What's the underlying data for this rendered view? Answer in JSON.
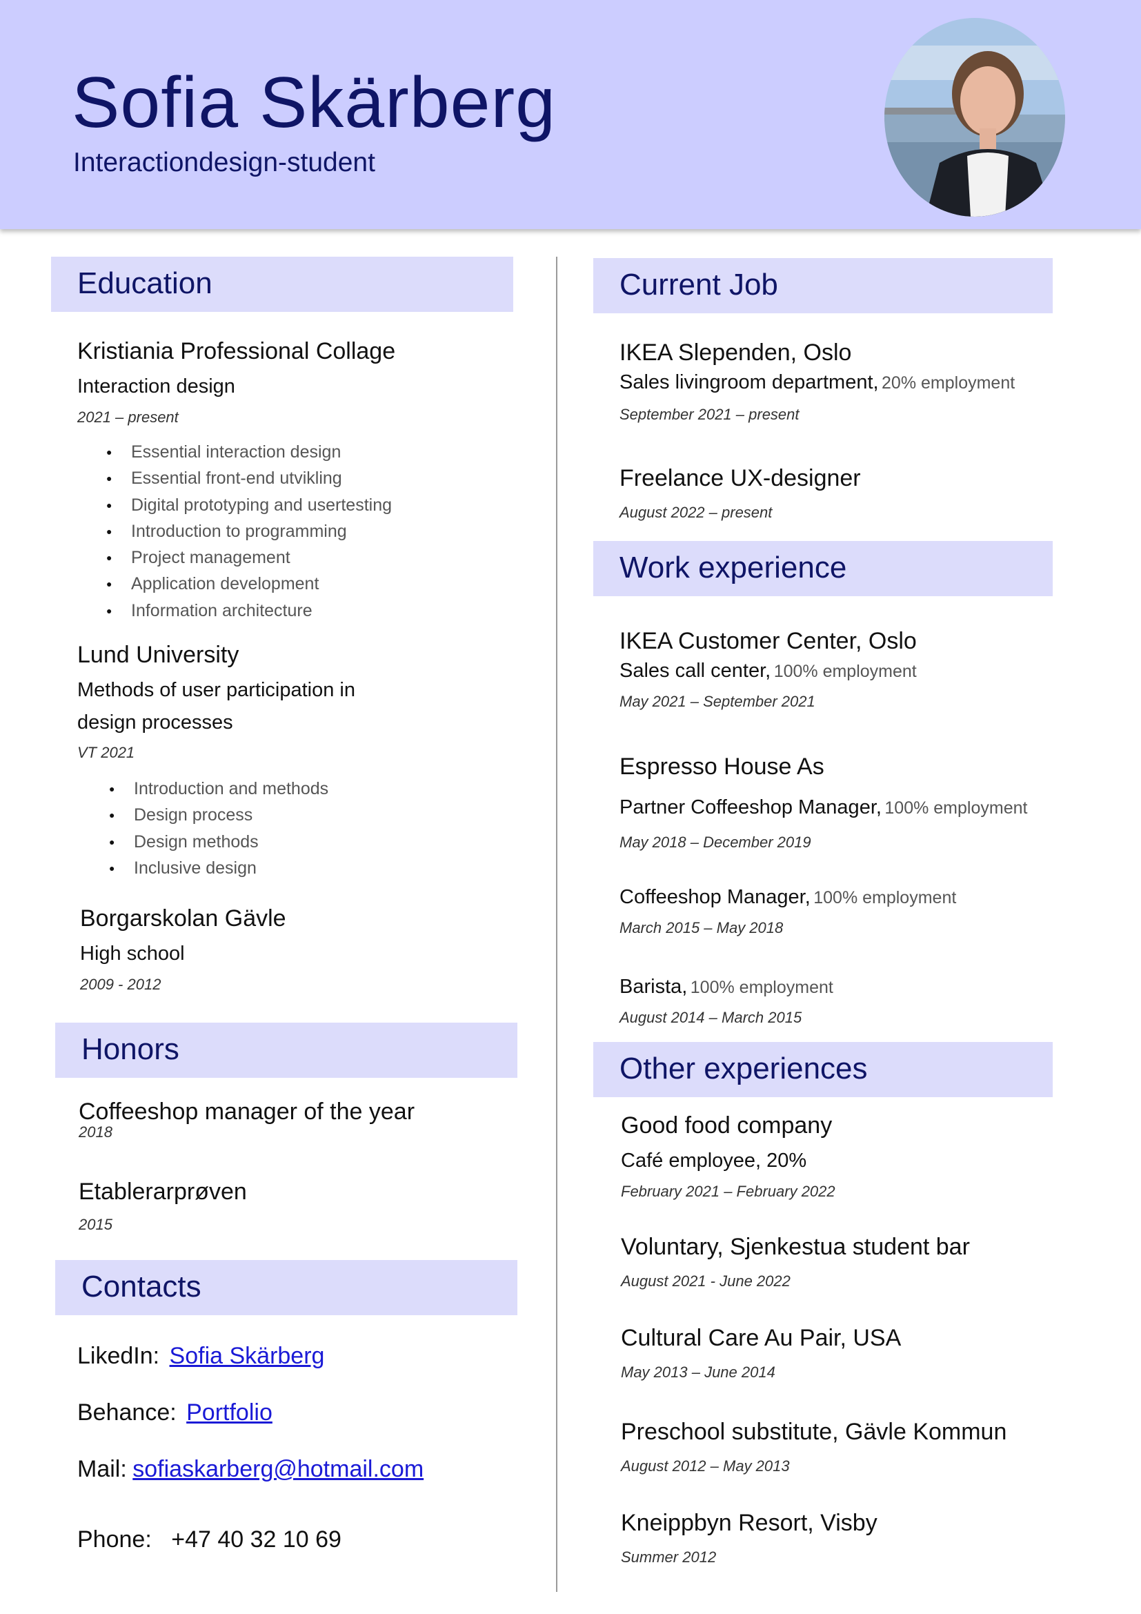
{
  "header": {
    "name": "Sofia Skärberg",
    "subtitle": "Interactiondesign-student"
  },
  "education": {
    "title": "Education",
    "kristiania": {
      "school": "Kristiania Professional Collage",
      "program": "Interaction design",
      "date": "2021 – present",
      "courses": [
        "Essential interaction design",
        "Essential front-end utvikling",
        "Digital prototyping and usertesting",
        "Introduction to programming",
        "Project management",
        "Application development",
        "Information architecture"
      ]
    },
    "lund": {
      "school": "Lund University",
      "program_line1": "Methods of user participation in",
      "program_line2": "design processes",
      "date": "VT 2021",
      "courses": [
        "Introduction and methods",
        "Design process",
        "Design methods",
        "Inclusive design"
      ]
    },
    "borgar": {
      "school": "Borgarskolan Gävle",
      "program": "High school",
      "date": "2009 - 2012"
    }
  },
  "honors": {
    "title": "Honors",
    "items": [
      {
        "name": "Coffeeshop manager of the year",
        "year": "2018"
      },
      {
        "name": "Etablerarprøven",
        "year": "2015"
      }
    ]
  },
  "contacts": {
    "title": "Contacts",
    "linkedin_label": "LikedIn:",
    "linkedin_value": "Sofia Skärberg",
    "behance_label": "Behance:",
    "behance_value": "Portfolio",
    "mail_label": "Mail:",
    "mail_value": "sofiaskarberg@hotmail.com",
    "phone_label": "Phone:",
    "phone_value": "+47 40 32 10 69"
  },
  "current_job": {
    "title": "Current Job",
    "ikea": {
      "org": "IKEA Slependen, Oslo",
      "role": "Sales livingroom department,",
      "emp": "20% employment",
      "date": "September 2021 – present"
    },
    "freelance": {
      "org": "Freelance UX-designer",
      "date": "August 2022 – present"
    }
  },
  "work": {
    "title": "Work experience",
    "ikea": {
      "org": "IKEA Customer Center, Oslo",
      "role": "Sales call center,",
      "emp": "100% employment",
      "date": "May 2021 – September 2021"
    },
    "espresso": {
      "org": "Espresso House As",
      "role": "Partner Coffeeshop Manager,",
      "emp": "100% employment",
      "date": "May 2018 – December 2019"
    },
    "manager": {
      "role": "Coffeeshop Manager,",
      "emp": "100% employment",
      "date": "March 2015 – May 2018"
    },
    "barista": {
      "role": "Barista,",
      "emp": "100% employment",
      "date": "August 2014 – March 2015"
    }
  },
  "other": {
    "title": "Other experiences",
    "goodfood": {
      "org": "Good food company",
      "role": "Café employee, 20%",
      "date": "February 2021 – February 2022"
    },
    "voluntary": {
      "org": "Voluntary, Sjenkestua student bar",
      "date": "August 2021 - June 2022"
    },
    "aupair": {
      "org": "Cultural Care Au Pair, USA",
      "date": "May 2013 – June 2014"
    },
    "preschool": {
      "org": "Preschool substitute, Gävle Kommun",
      "date": "August 2012 – May 2013"
    },
    "kneipp": {
      "org": "Kneippbyn Resort, Visby",
      "date": "Summer 2012"
    }
  }
}
